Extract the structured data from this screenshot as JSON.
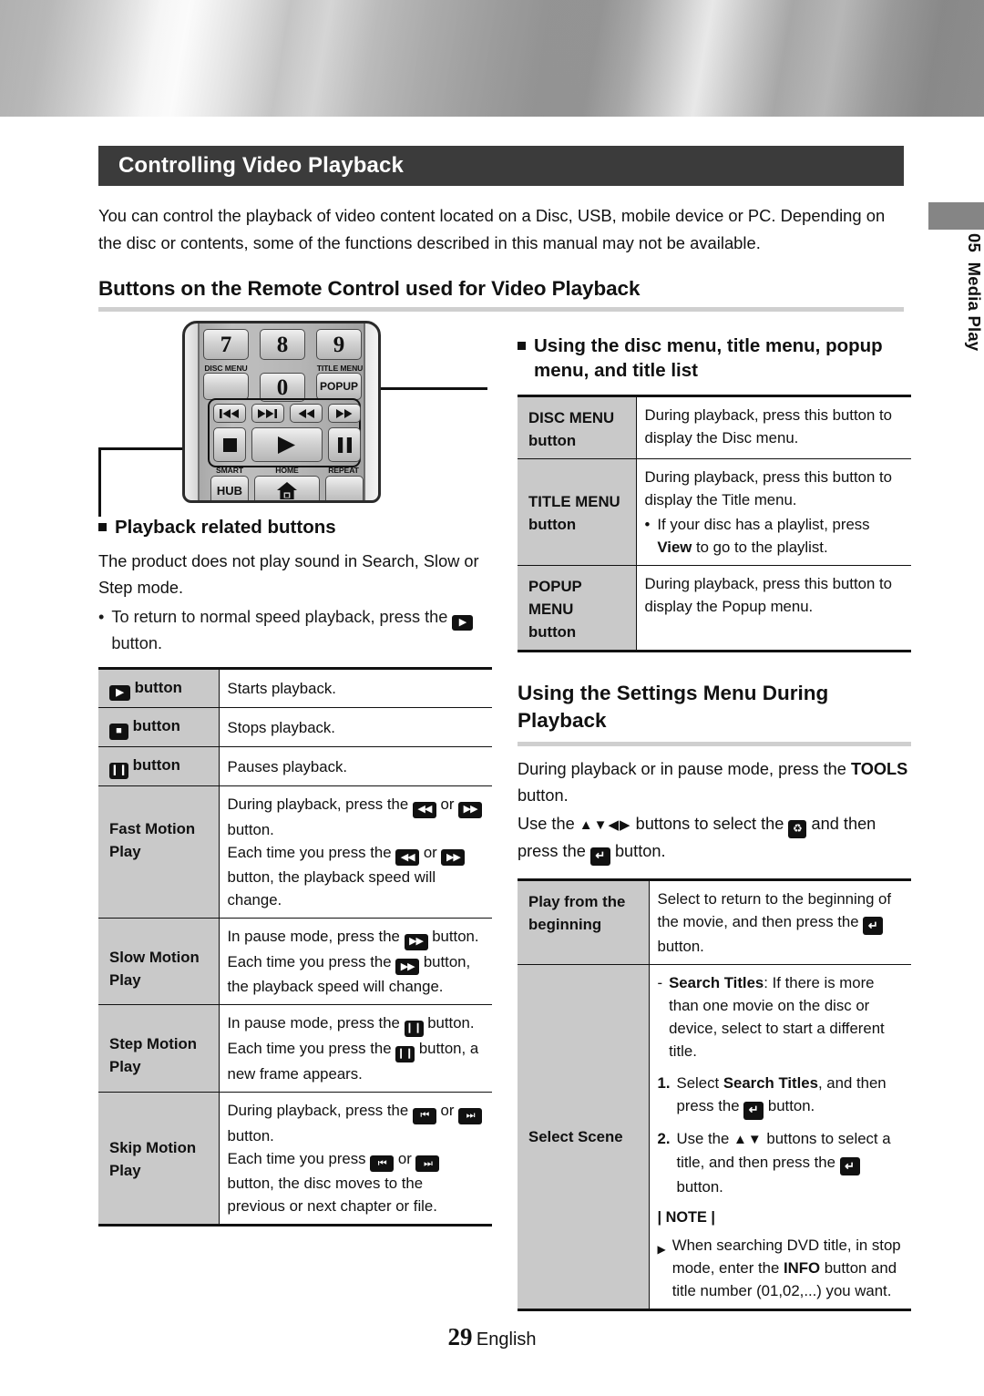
{
  "chapter_tab": {
    "number": "05",
    "label": "Media Play"
  },
  "section": {
    "title": "Controlling Video Playback",
    "intro": "You can control the playback of video content located on a Disc, USB, mobile device or PC. Depending on the disc or contents, some of the functions described in this manual may not be available.",
    "subheading": "Buttons on the Remote Control used for Video Playback"
  },
  "remote": {
    "keys": [
      {
        "name": "7",
        "label": "7"
      },
      {
        "name": "8",
        "label": "8"
      },
      {
        "name": "9",
        "label": "9"
      },
      {
        "name": "0",
        "label": "0"
      },
      {
        "name": "popup",
        "label": "POPUP"
      },
      {
        "name": "smart-hub",
        "label": "HUB"
      }
    ],
    "captions": {
      "disc_menu": "DISC MENU",
      "title_menu": "TITLE MENU",
      "smart": "SMART",
      "home": "HOME",
      "repeat": "REPEAT"
    },
    "transport_icons": [
      "prev-track-icon",
      "next-track-icon",
      "rewind-icon",
      "fast-forward-icon",
      "stop-icon",
      "play-icon",
      "pause-icon"
    ]
  },
  "left": {
    "heading": "Playback related buttons",
    "para": "The product does not play sound in Search, Slow or Step mode.",
    "bullet": {
      "pre": "To return to normal speed playback, press the",
      "post": "button."
    },
    "table": [
      {
        "key_pre": "",
        "key_icon": "play-icon",
        "key_post": "button",
        "value": "Starts playback."
      },
      {
        "key_pre": "",
        "key_icon": "stop-icon",
        "key_post": "button",
        "value": "Stops playback."
      },
      {
        "key_pre": "",
        "key_icon": "pause-icon",
        "key_post": "button",
        "value": "Pauses playback."
      },
      {
        "key": "Fast Motion Play",
        "lines": [
          "During playback, press the [rewind] or [fast-forward] button.",
          "Each time you press the [rewind] or [fast-forward] button, the playback speed will change."
        ]
      },
      {
        "key": "Slow Motion Play",
        "lines": [
          "In pause mode, press the [fast-forward] button.",
          "Each time you press the [fast-forward] button, the playback speed will change."
        ]
      },
      {
        "key": "Step Motion Play",
        "lines": [
          "In pause mode, press the [pause] button.",
          "Each time you press the [pause] button, a new frame appears."
        ]
      },
      {
        "key": "Skip Motion Play",
        "lines": [
          "During playback, press the [prev] or [next] button.",
          "Each time you press [prev] or [next] button, the disc moves to the previous or next chapter or file."
        ]
      }
    ]
  },
  "right": {
    "heading": "Using the disc menu, title menu, popup menu, and title list",
    "menu_table": [
      {
        "key": "DISC MENU button",
        "key_l1": "DISC MENU",
        "key_l2": "button",
        "value": "During playback, press this button to display the Disc menu."
      },
      {
        "key": "TITLE MENU button",
        "key_l1": "TITLE MENU",
        "key_l2": "button",
        "value": "During playback, press this button to display the Title menu.",
        "sub_pre": "If your disc has a playlist, press",
        "sub_bold": "View",
        "sub_post": "to go to the playlist."
      },
      {
        "key": "POPUP MENU button",
        "key_l1": "POPUP MENU",
        "key_l2": "button",
        "value": "During playback, press this button to display the Popup menu."
      }
    ],
    "settings_heading": "Using the Settings Menu During Playback",
    "settings_para1_pre": "During playback or in pause mode, press the",
    "settings_para1_bold": "TOOLS",
    "settings_para1_post": "button.",
    "settings_para2_a": "Use the",
    "settings_para2_b": "buttons to select the",
    "settings_para2_c": "and then press the",
    "settings_para2_d": "button.",
    "settings_table": {
      "row1_key_l1": "Play from the",
      "row1_key_l2": "beginning",
      "row1_value_a": "Select to return to the beginning of the movie, and then press the",
      "row1_value_b": "button.",
      "row2_key": "Select Scene",
      "row2_dash_bold": "Search Titles",
      "row2_dash_text": ": If there is more than one movie on the disc or device, select to start a different title.",
      "row2_step1_a": "Select",
      "row2_step1_bold": "Search Titles",
      "row2_step1_b": ", and then press the",
      "row2_step1_c": "button.",
      "row2_step1_num": "1.",
      "row2_step2_num": "2.",
      "row2_step2_a": "Use the",
      "row2_step2_b": "buttons to select a title, and then press the",
      "row2_step2_c": "button.",
      "note_label": "| NOTE |",
      "note_a": "When searching DVD title, in stop mode, enter the",
      "note_bold": "INFO",
      "note_b": "button and title number (01,02,...) you want."
    }
  },
  "footer": {
    "page": "29",
    "language": "English"
  }
}
